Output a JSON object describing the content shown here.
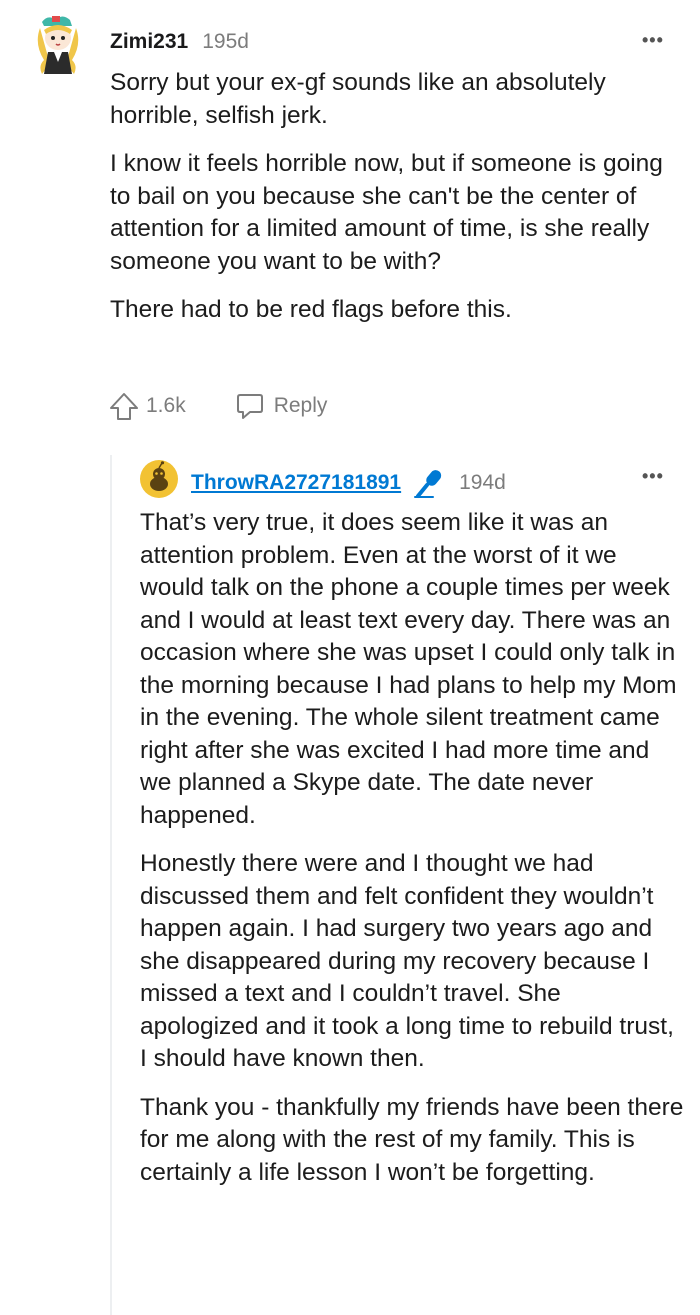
{
  "comment": {
    "author": "Zimi231",
    "age": "195d",
    "menu_icon": "more-options-icon",
    "paragraphs": [
      "Sorry but your ex-gf sounds like an absolutely horrible, selfish jerk.",
      "I know it feels horrible now, but if someone is going to bail on you because she can't be the center of attention for a limited amount of time, is she really someone you want to be with?",
      "There had to be red flags before this."
    ],
    "upvotes": "1.6k",
    "reply_label": "Reply"
  },
  "reply": {
    "author": "ThrowRA2727181891",
    "badge_icon": "microphone-icon",
    "age": "194d",
    "menu_icon": "more-options-icon",
    "paragraphs": [
      "That’s very true, it does seem like it was an attention problem. Even at the worst of it we would talk on the phone a couple times per week and I would at least text every day. There was an occasion where she was upset I could only talk in the morning because I had plans to help my Mom in the evening. The whole silent treatment came right after she was excited I had more time and we planned a Skype date. The date never happened.",
      "Honestly there were and I thought we had discussed them and felt confident they wouldn’t happen again. I had surgery two years ago and she disappeared during my recovery because I missed a text and I couldn’t travel. She apologized and it took a long time to rebuild trust, I should have known then.",
      "Thank you - thankfully my friends have been there for me along with the rest of my family. This is certainly a life lesson I won’t be forgetting."
    ]
  },
  "colors": {
    "accent_link": "#0079d3",
    "meta": "#7c7c7c",
    "avatar2_bg": "#f2c233"
  }
}
